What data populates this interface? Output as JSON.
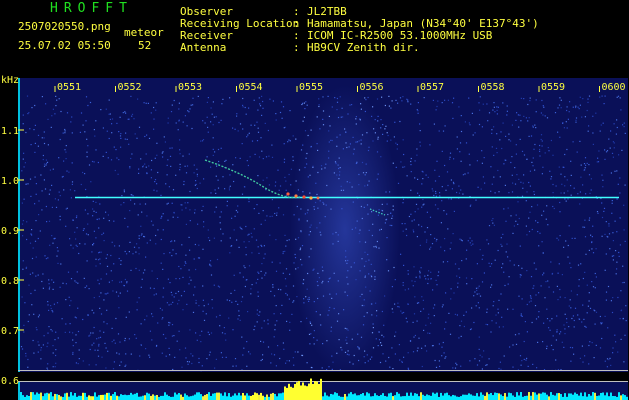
{
  "app": {
    "title": "HROFFT"
  },
  "file": {
    "name": "2507020550.png",
    "datetime": "25.07.02 05:50"
  },
  "meteor": {
    "label": "meteor",
    "count": "52"
  },
  "info": [
    {
      "label": "Observer",
      "value": "JL2TBB"
    },
    {
      "label": "Receiving Location",
      "value": "Hamamatsu, Japan (N34°40' E137°43')"
    },
    {
      "label": "Receiver",
      "value": "ICOM IC-R2500 53.1000MHz USB"
    },
    {
      "label": "Antenna",
      "value": "HB9CV Zenith dir."
    }
  ],
  "axis": {
    "y_unit": "kHz",
    "x_ticks": [
      "0551",
      "0552",
      "0553",
      "0554",
      "0555",
      "0556",
      "0557",
      "0558",
      "0559",
      "0600"
    ],
    "y_ticks": [
      "1.1",
      "1.0",
      "0.9",
      "0.8",
      "0.7",
      "0.6"
    ],
    "y_values": [
      1.1,
      1.0,
      0.9,
      0.8,
      0.7,
      0.6
    ]
  },
  "colors": {
    "background": "#0a1058",
    "carrier": "#40ffff",
    "axis_text": "#ffff40",
    "noise_bar": "#00e8ff"
  },
  "signal": {
    "carrier_khz": 0.967
  }
}
